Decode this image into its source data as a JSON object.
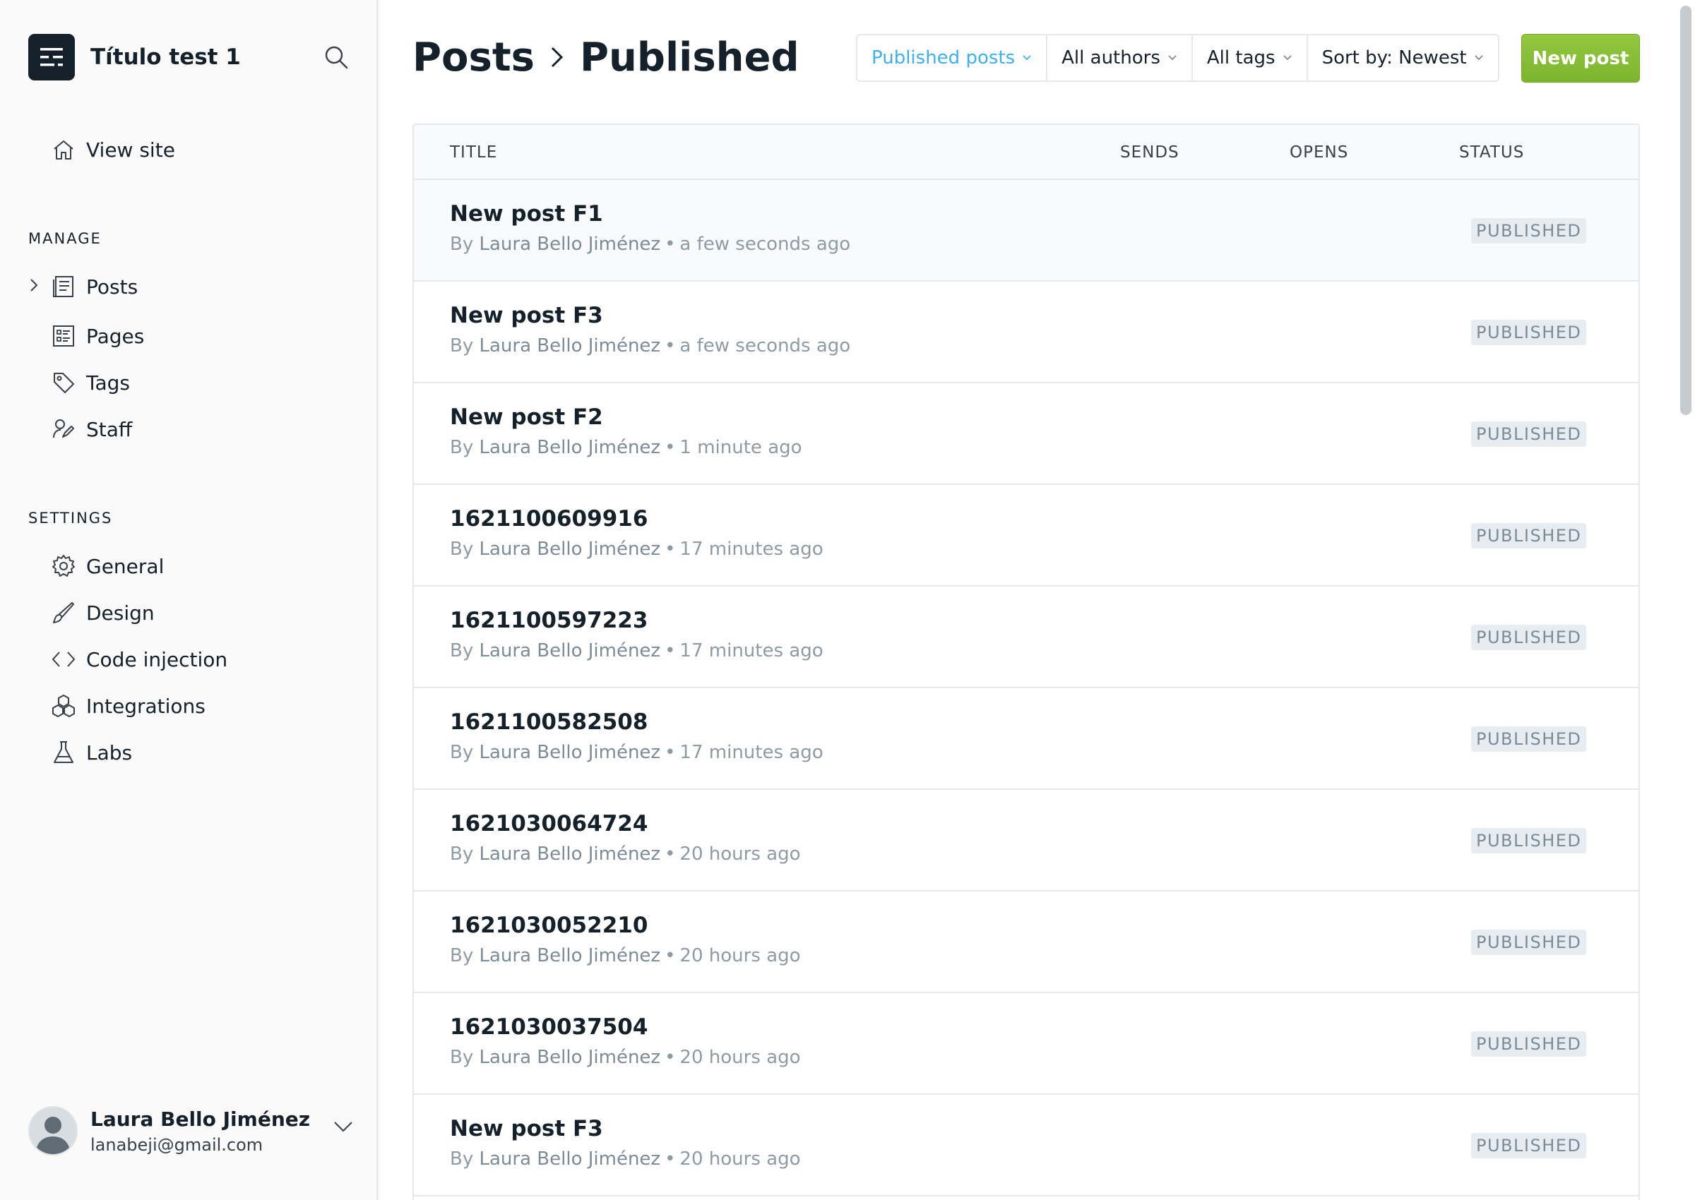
{
  "brand": {
    "title": "Título test 1"
  },
  "sidebar": {
    "view_site": "View site",
    "manage_heading": "MANAGE",
    "manage_items": [
      {
        "label": "Posts",
        "icon": "posts-icon"
      },
      {
        "label": "Pages",
        "icon": "pages-icon"
      },
      {
        "label": "Tags",
        "icon": "tag-icon"
      },
      {
        "label": "Staff",
        "icon": "staff-icon"
      }
    ],
    "settings_heading": "SETTINGS",
    "settings_items": [
      {
        "label": "General",
        "icon": "gear-icon"
      },
      {
        "label": "Design",
        "icon": "brush-icon"
      },
      {
        "label": "Code injection",
        "icon": "code-icon"
      },
      {
        "label": "Integrations",
        "icon": "integrations-icon"
      },
      {
        "label": "Labs",
        "icon": "flask-icon"
      }
    ],
    "user": {
      "name": "Laura Bello Jiménez",
      "email": "lanabeji@gmail.com"
    }
  },
  "header": {
    "breadcrumb_root": "Posts",
    "breadcrumb_current": "Published",
    "filters": [
      {
        "label": "Published posts",
        "active": true
      },
      {
        "label": "All authors",
        "active": false
      },
      {
        "label": "All tags",
        "active": false
      },
      {
        "label": "Sort by: Newest",
        "active": false
      }
    ],
    "new_post_label": "New post"
  },
  "table": {
    "columns": {
      "title": "TITLE",
      "sends": "SENDS",
      "opens": "OPENS",
      "status": "STATUS"
    },
    "by_label": "By",
    "rows": [
      {
        "title": "New post F1",
        "author": "Laura Bello Jiménez",
        "time": "a few seconds ago",
        "status": "PUBLISHED"
      },
      {
        "title": "New post F3",
        "author": "Laura Bello Jiménez",
        "time": "a few seconds ago",
        "status": "PUBLISHED"
      },
      {
        "title": "New post F2",
        "author": "Laura Bello Jiménez",
        "time": "1 minute ago",
        "status": "PUBLISHED"
      },
      {
        "title": "1621100609916",
        "author": "Laura Bello Jiménez",
        "time": "17 minutes ago",
        "status": "PUBLISHED"
      },
      {
        "title": "1621100597223",
        "author": "Laura Bello Jiménez",
        "time": "17 minutes ago",
        "status": "PUBLISHED"
      },
      {
        "title": "1621100582508",
        "author": "Laura Bello Jiménez",
        "time": "17 minutes ago",
        "status": "PUBLISHED"
      },
      {
        "title": "1621030064724",
        "author": "Laura Bello Jiménez",
        "time": "20 hours ago",
        "status": "PUBLISHED"
      },
      {
        "title": "1621030052210",
        "author": "Laura Bello Jiménez",
        "time": "20 hours ago",
        "status": "PUBLISHED"
      },
      {
        "title": "1621030037504",
        "author": "Laura Bello Jiménez",
        "time": "20 hours ago",
        "status": "PUBLISHED"
      },
      {
        "title": "New post F3",
        "author": "Laura Bello Jiménez",
        "time": "20 hours ago",
        "status": "PUBLISHED"
      }
    ]
  },
  "colors": {
    "accent": "#3eb0ef",
    "primary_button": "#8dc63f",
    "text": "#15212a",
    "muted": "#8e9aa4"
  }
}
